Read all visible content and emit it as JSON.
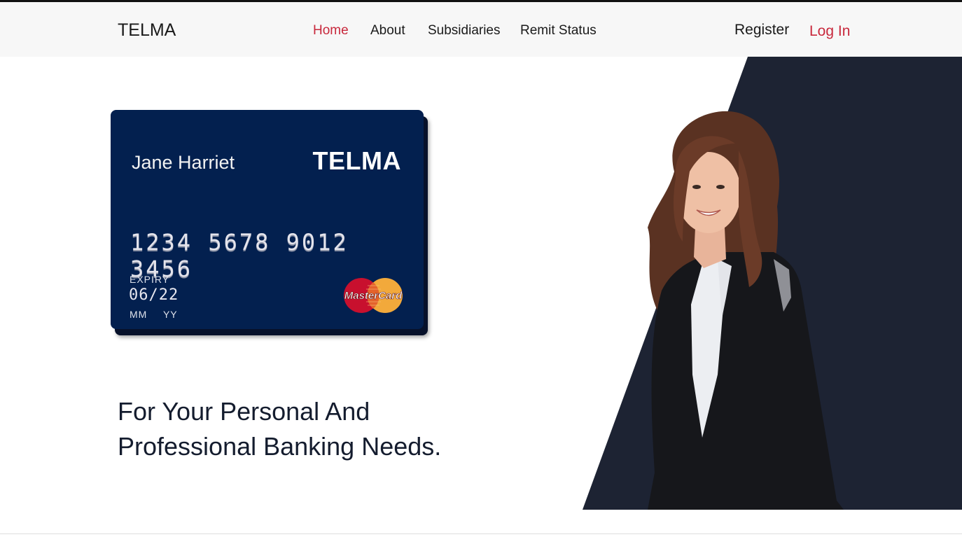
{
  "nav": {
    "brand": "TELMA",
    "links": [
      {
        "label": "Home",
        "active": true
      },
      {
        "label": "About",
        "active": false
      },
      {
        "label": "Subsidiaries",
        "active": false
      },
      {
        "label": "Remit Status",
        "active": false
      }
    ],
    "register_label": "Register",
    "login_label": "Log In"
  },
  "colors": {
    "accent": "#c8283c",
    "card_background": "#03204f",
    "panel_background": "#1d2333"
  },
  "card": {
    "holder_name": "Jane Harriet",
    "brand": "TELMA",
    "number": "1234 5678 9012 3456",
    "expiry_label": "EXPIRY",
    "expiry_value": "06/22",
    "expiry_sub": "MM YY",
    "network_logo": "MasterCard"
  },
  "hero": {
    "tagline_line1": "For Your Personal And",
    "tagline_line2": "Professional Banking Needs."
  },
  "images": {
    "person": "smiling-businesswoman-photo"
  }
}
